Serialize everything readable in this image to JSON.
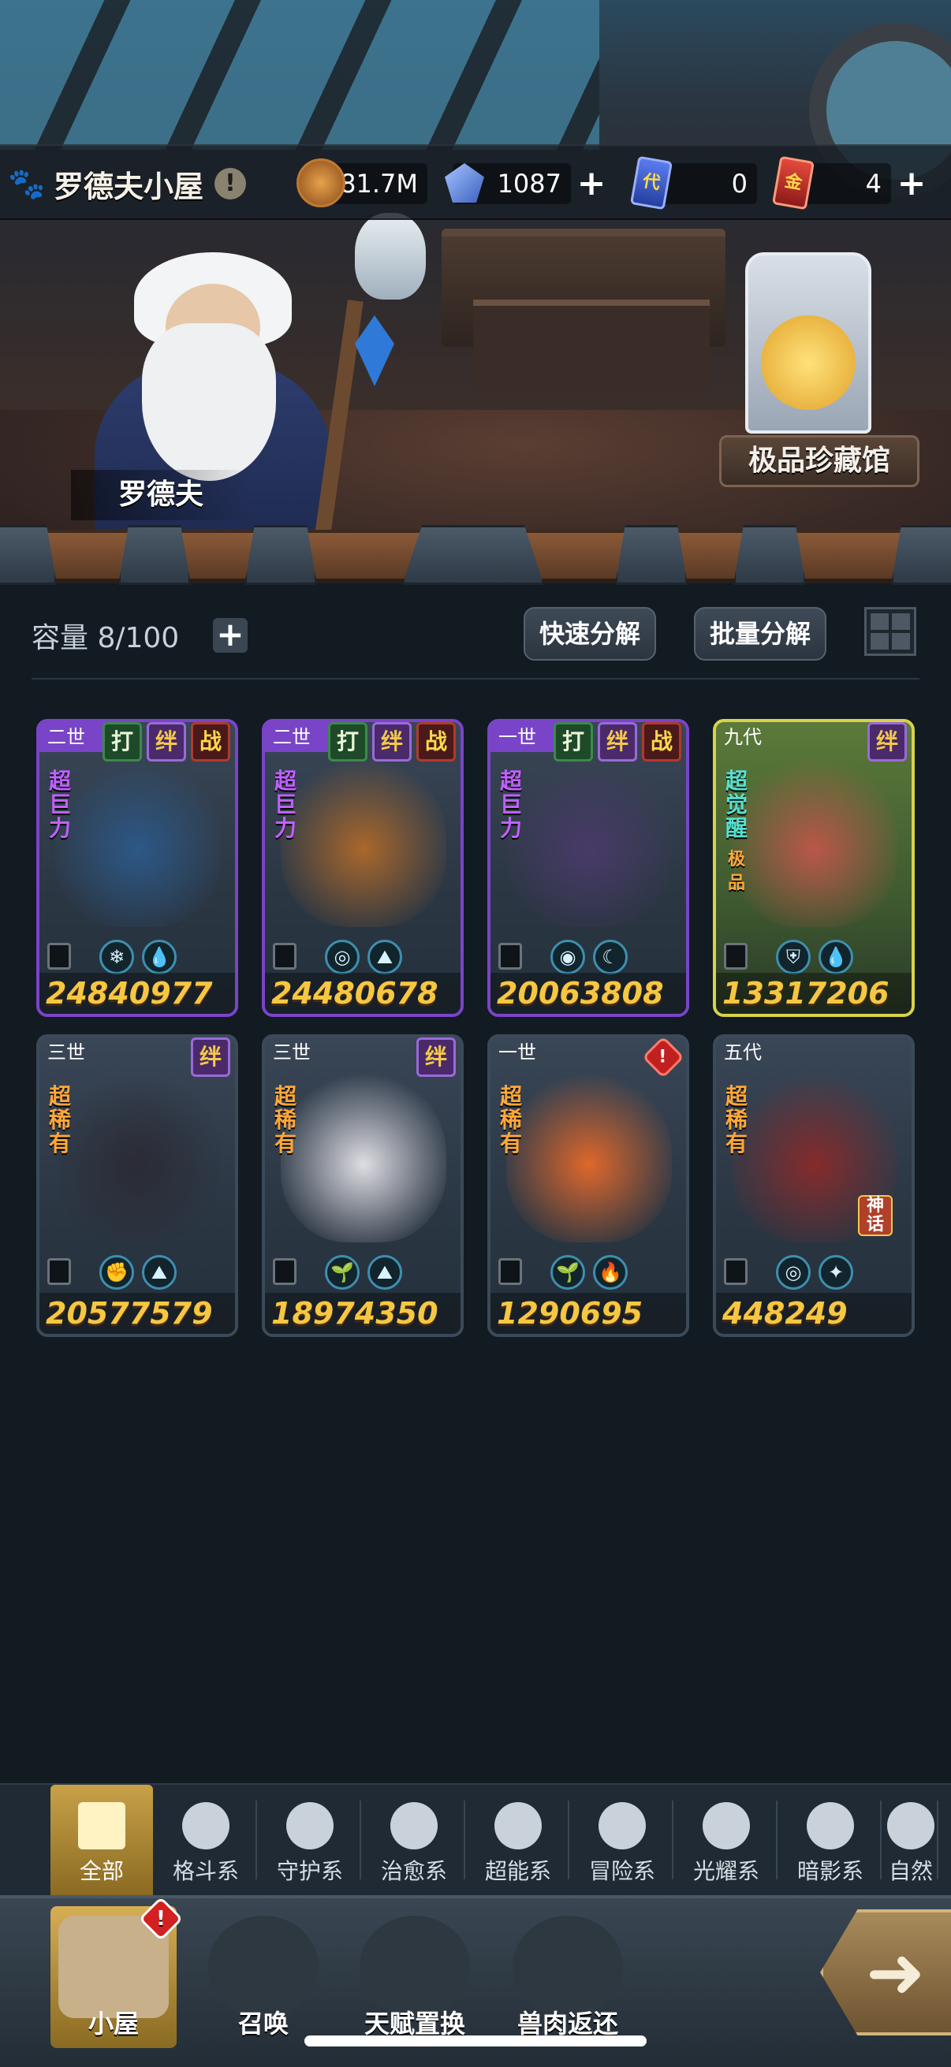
{
  "header": {
    "house_title": "罗德夫小屋",
    "info_icon": "info-icon",
    "resources": [
      {
        "name": "coin",
        "icon": "coin-icon",
        "value": "81.7M",
        "has_plus": false
      },
      {
        "name": "crystal",
        "icon": "crystal-icon",
        "value": "1087",
        "has_plus": true
      },
      {
        "name": "card-ticket",
        "icon": "card-icon",
        "icon_text": "代",
        "value": "0",
        "has_plus": false
      },
      {
        "name": "gold-ticket",
        "icon": "gold-card-icon",
        "icon_text": "金",
        "value": "4",
        "has_plus": true
      }
    ]
  },
  "scene": {
    "npc_name": "罗德夫",
    "museum_label": "极品珍藏馆"
  },
  "inventory": {
    "capacity_label": "容量 8/100",
    "quick_decompose": "快速分解",
    "batch_decompose": "批量分解"
  },
  "cards": [
    {
      "gen": "二世",
      "tags": [
        "打",
        "绊",
        "战"
      ],
      "rarity": "超巨力",
      "rarity_color": "purple",
      "power": "24840977",
      "elements": [
        "ice-icon",
        "water-icon"
      ],
      "frame": "purple",
      "art_color": "#2c5a8a"
    },
    {
      "gen": "二世",
      "tags": [
        "打",
        "绊",
        "战"
      ],
      "rarity": "超巨力",
      "rarity_color": "purple",
      "power": "24480678",
      "elements": [
        "guard-icon",
        "earth-icon"
      ],
      "frame": "purple",
      "art_color": "#b06a2a"
    },
    {
      "gen": "一世",
      "tags": [
        "打",
        "绊",
        "战"
      ],
      "rarity": "超巨力",
      "rarity_color": "purple",
      "power": "20063808",
      "elements": [
        "eye-icon",
        "moon-icon"
      ],
      "frame": "purple",
      "art_color": "#4a3a6a"
    },
    {
      "gen": "九代",
      "tags": [
        "绊"
      ],
      "rarity": "超觉醒",
      "rarity_color": "teal",
      "sub_rarity": "极品",
      "power": "13317206",
      "elements": [
        "shield-icon",
        "water-icon"
      ],
      "frame": "gold",
      "art_color": "#c0564a"
    },
    {
      "gen": "三世",
      "tags": [
        "绊"
      ],
      "rarity": "超稀有",
      "rarity_color": "orange",
      "power": "20577579",
      "elements": [
        "fist-icon",
        "earth-icon"
      ],
      "frame": "plain",
      "art_color": "#2a2a34"
    },
    {
      "gen": "三世",
      "tags": [
        "绊"
      ],
      "rarity": "超稀有",
      "rarity_color": "orange",
      "power": "18974350",
      "elements": [
        "sprout-icon",
        "earth-icon"
      ],
      "frame": "plain",
      "art_color": "#e8e6ec"
    },
    {
      "gen": "一世",
      "tags": [
        "!"
      ],
      "rarity": "超稀有",
      "rarity_color": "orange",
      "power": "1290695",
      "elements": [
        "sprout-icon",
        "fire-icon"
      ],
      "frame": "plain",
      "art_color": "#e86a2a"
    },
    {
      "gen": "五代",
      "tags": [],
      "rarity": "超稀有",
      "rarity_color": "orange",
      "badge": "神话",
      "power": "448249",
      "elements": [
        "guard-icon",
        "star-icon"
      ],
      "frame": "plain",
      "art_color": "#8a2a2a"
    }
  ],
  "categories": [
    {
      "label": "全部",
      "icon": "all-grid-icon",
      "active": true
    },
    {
      "label": "格斗系",
      "icon": "fist-icon"
    },
    {
      "label": "守护系",
      "icon": "shield-icon"
    },
    {
      "label": "治愈系",
      "icon": "sprout-icon"
    },
    {
      "label": "超能系",
      "icon": "alien-icon"
    },
    {
      "label": "冒险系",
      "icon": "adventure-icon"
    },
    {
      "label": "光耀系",
      "icon": "sparkle-icon"
    },
    {
      "label": "暗影系",
      "icon": "eye-icon"
    },
    {
      "label": "自然",
      "icon": "leaf-icon"
    }
  ],
  "nav": [
    {
      "label": "小屋",
      "icon": "house-icon",
      "active": true,
      "badge": "!"
    },
    {
      "label": "召唤",
      "icon": "egg-icon"
    },
    {
      "label": "天赋置换",
      "icon": "swap-icon"
    },
    {
      "label": "兽肉返还",
      "icon": "meat-icon"
    }
  ],
  "next_button_icon": "arrow-right-icon"
}
